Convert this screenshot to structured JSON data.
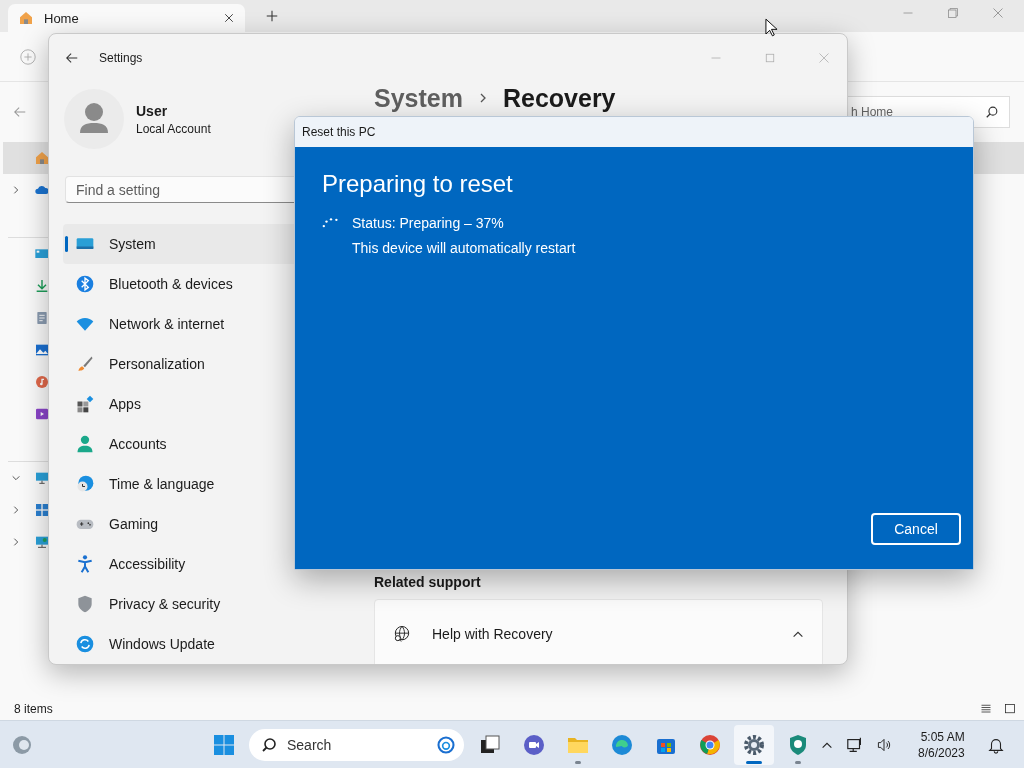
{
  "explorer": {
    "tab": {
      "label": "Home"
    },
    "search": {
      "placeholder": "h Home"
    },
    "nav_groups": [
      [
        {
          "kind": "home",
          "selected": true
        },
        {
          "kind": "onedrive",
          "selected": false,
          "expanded": false
        }
      ],
      [
        {
          "kind": "desktop",
          "selected": false
        },
        {
          "kind": "downloads",
          "selected": false
        },
        {
          "kind": "documents",
          "selected": false
        },
        {
          "kind": "pictures",
          "selected": false
        },
        {
          "kind": "music",
          "selected": false
        },
        {
          "kind": "videos",
          "selected": false
        }
      ],
      [
        {
          "kind": "thispc",
          "selected": false,
          "expanded": true
        },
        {
          "kind": "drive",
          "selected": false,
          "expanded": false
        },
        {
          "kind": "network",
          "selected": false,
          "expanded": false
        }
      ]
    ],
    "status_bar": "8 items"
  },
  "settings": {
    "title": "Settings",
    "user": {
      "name": "User",
      "account": "Local Account"
    },
    "search": {
      "placeholder": "Find a setting"
    },
    "nav": [
      {
        "label": "System",
        "kind": "system",
        "selected": true
      },
      {
        "label": "Bluetooth & devices",
        "kind": "bluetooth",
        "selected": false
      },
      {
        "label": "Network & internet",
        "kind": "network",
        "selected": false
      },
      {
        "label": "Personalization",
        "kind": "personalization",
        "selected": false
      },
      {
        "label": "Apps",
        "kind": "apps",
        "selected": false
      },
      {
        "label": "Accounts",
        "kind": "accounts",
        "selected": false
      },
      {
        "label": "Time & language",
        "kind": "time",
        "selected": false
      },
      {
        "label": "Gaming",
        "kind": "gaming",
        "selected": false
      },
      {
        "label": "Accessibility",
        "kind": "accessibility",
        "selected": false
      },
      {
        "label": "Privacy & security",
        "kind": "privacy",
        "selected": false
      },
      {
        "label": "Windows Update",
        "kind": "update",
        "selected": false
      }
    ],
    "breadcrumb": [
      "System",
      "Recovery"
    ],
    "related_support": {
      "heading": "Related support",
      "items": [
        {
          "label": "Help with Recovery",
          "expanded": true
        }
      ]
    }
  },
  "dialog": {
    "title": "Reset this PC",
    "heading": "Preparing to reset",
    "status": "Status: Preparing – 37%",
    "note": "This device will automatically restart",
    "button": "Cancel"
  },
  "taskbar": {
    "search": {
      "placeholder": "Search"
    },
    "apps": [
      {
        "kind": "taskview",
        "running": false,
        "selected": false
      },
      {
        "kind": "chat",
        "running": false,
        "selected": false
      },
      {
        "kind": "explorer",
        "running": true,
        "selected": false
      },
      {
        "kind": "edge",
        "running": false,
        "selected": false
      },
      {
        "kind": "store",
        "running": false,
        "selected": false
      },
      {
        "kind": "chrome",
        "running": false,
        "selected": false
      },
      {
        "kind": "settings",
        "running": true,
        "selected": true
      },
      {
        "kind": "defender",
        "running": true,
        "selected": false
      }
    ],
    "clock": {
      "time": "5:05 AM",
      "date": "8/6/2023"
    }
  }
}
